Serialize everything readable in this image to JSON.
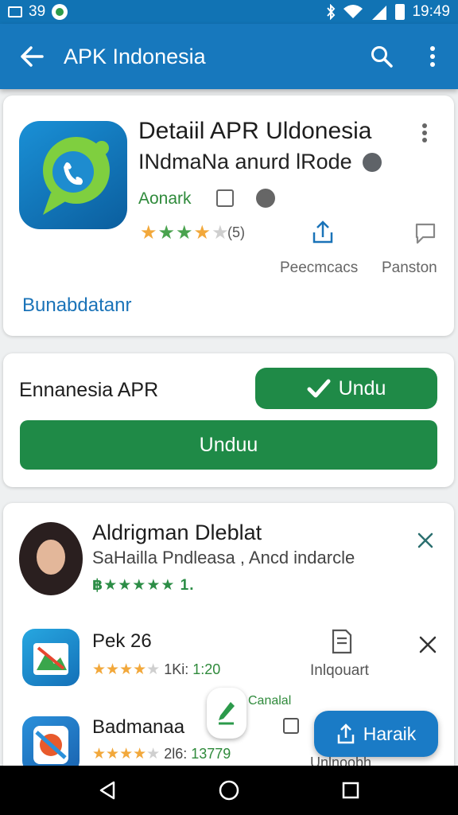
{
  "status_bar": {
    "notif_count": "39",
    "time": "19:49"
  },
  "app_bar": {
    "title": "APK Indonesia"
  },
  "app_card": {
    "name": "Detaiil APR Uldonesia",
    "developer": "INdmaNa anurd lRode",
    "green_label": "Aonark",
    "rating_stars": "★★★★",
    "rating_count": "(5)",
    "action1_label": "Peecmcacs",
    "action2_label": "Panston",
    "link_label": "Bunabdatanr"
  },
  "download_card": {
    "label": "Ennanesia APR",
    "small_button_label": "Undu",
    "big_button_label": "Unduu"
  },
  "related": {
    "user": {
      "name": "Aldrigman Dleblat",
      "subtitle": "SaHailla Pndleasa , Ancd indarcle",
      "rating": "฿★★★★★ 1."
    },
    "item1": {
      "name": "Pek 26",
      "stars": "★★★★",
      "meta1": "1Ki:",
      "meta2": "1:20",
      "action_label": "Inlqouart"
    },
    "item2": {
      "name": "Badmanaa",
      "stars": "★★★★",
      "meta1": "2l6:",
      "meta2": "13779",
      "cut_label": "Unlnoobh"
    }
  },
  "mini_fab": {
    "label": "Canalal"
  },
  "fab": {
    "label": "Haraik"
  },
  "colors": {
    "primary": "#1778bd",
    "green": "#1f8a47",
    "star": "#f2a83b"
  }
}
